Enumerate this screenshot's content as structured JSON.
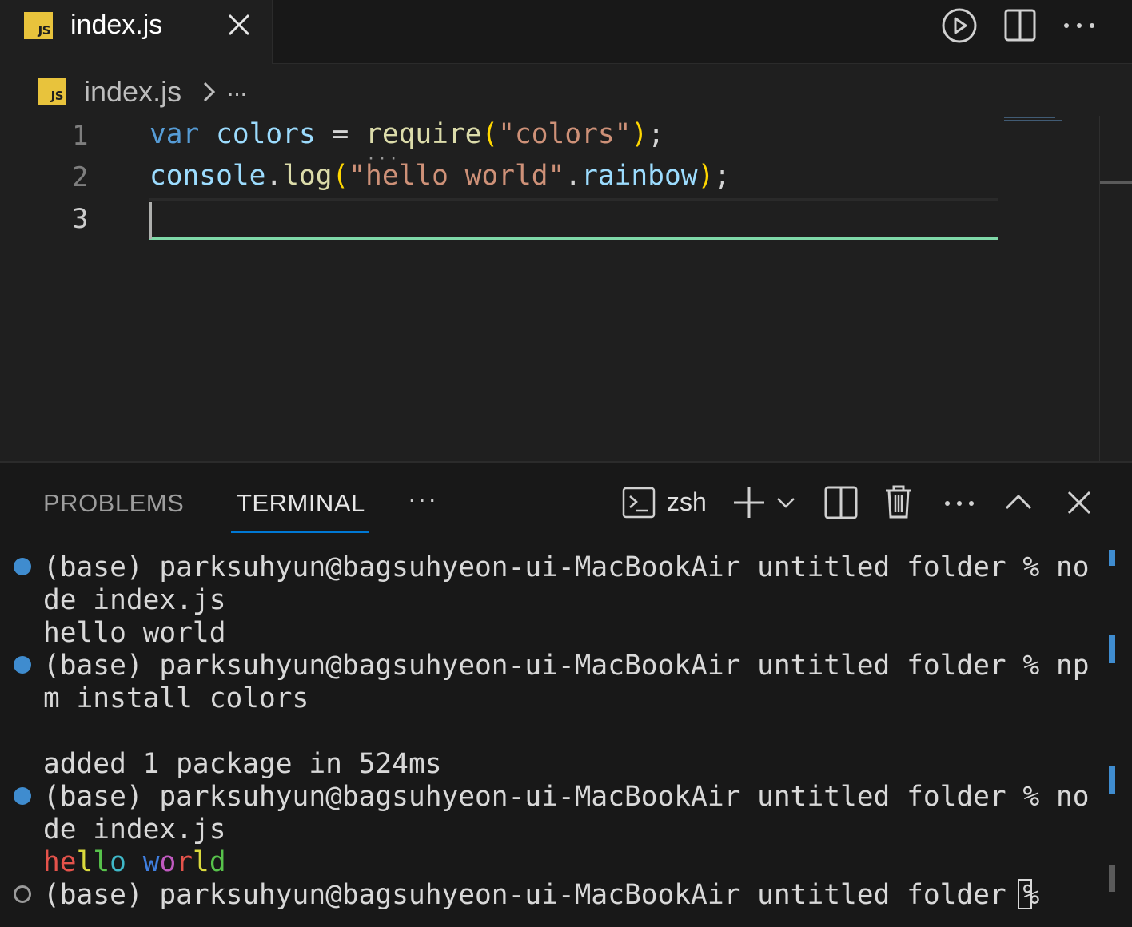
{
  "tab": {
    "icon_text": "JS",
    "title": "index.js"
  },
  "breadcrumb": {
    "icon_text": "JS",
    "file": "index.js",
    "more": "..."
  },
  "editor": {
    "line_numbers": [
      "1",
      "2",
      "3"
    ],
    "current_line": 3,
    "code_tokens": {
      "l1_var": "var",
      "l1_ident": "colors",
      "l1_eq": "=",
      "l1_fn": "require",
      "l1_open": "(",
      "l1_str": "\"colors\"",
      "l1_close": ")",
      "l1_semi": ";",
      "l2_console": "console",
      "l2_dot1": ".",
      "l2_log": "log",
      "l2_open": "(",
      "l2_str": "\"hello world\"",
      "l2_dot2": ".",
      "l2_prop": "rainbow",
      "l2_close": ")",
      "l2_semi": ";"
    }
  },
  "panel": {
    "tabs": [
      "PROBLEMS",
      "TERMINAL"
    ],
    "active_tab": "TERMINAL",
    "more": "···",
    "shell": "zsh"
  },
  "terminal": {
    "lines": [
      "(base) parksuhyun@bagsuhyeon-ui-MacBookAir untitled folder % no",
      "de index.js",
      "hello world",
      "(base) parksuhyun@bagsuhyeon-ui-MacBookAir untitled folder % np",
      "m install colors",
      "",
      "added 1 package in 524ms",
      "(base) parksuhyun@bagsuhyeon-ui-MacBookAir untitled folder % no",
      "de index.js",
      "hello world",
      "(base) parksuhyun@bagsuhyeon-ui-MacBookAir untitled folder % "
    ],
    "rainbow_colors": [
      "#e5534b",
      "#e5534b",
      "#d9d93d",
      "#57c24b",
      "#3fb8c8",
      "#3f7fe0",
      "#c05ac0",
      "#e5534b",
      "#d9d93d",
      "#57c24b",
      "#3fb8c8"
    ]
  },
  "colors": {
    "accent": "#0078d4",
    "js_badge": "#e8c33c",
    "current_line": "#7fd8a8",
    "command_decoration": "#3f8ccf"
  },
  "icons": [
    "run-icon",
    "split-editor-icon",
    "more-actions-icon",
    "close-icon",
    "terminal-icon",
    "new-terminal-icon",
    "chevron-down-icon",
    "split-terminal-icon",
    "trash-icon",
    "maximize-panel-icon"
  ]
}
